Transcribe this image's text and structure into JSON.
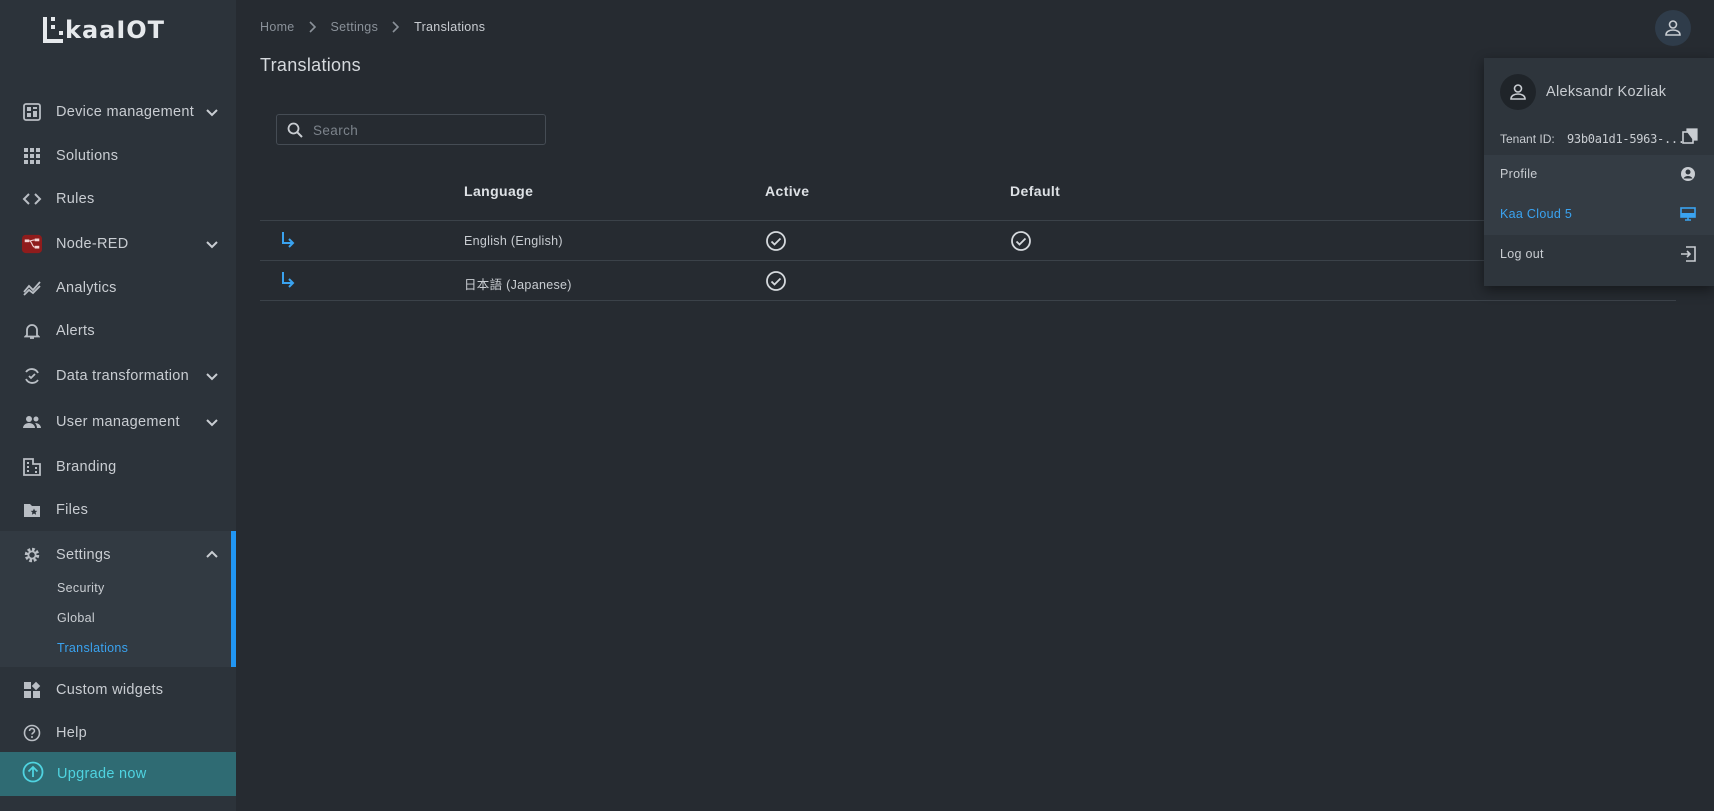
{
  "app": {
    "logo_text": "kaaIOT"
  },
  "sidebar": {
    "items": [
      {
        "label": "Device management",
        "icon": "device-dashboard-icon",
        "expandable": true
      },
      {
        "label": "Solutions",
        "icon": "grid-icon"
      },
      {
        "label": "Rules",
        "icon": "code-icon"
      },
      {
        "label": "Node-RED",
        "icon": "node-red-icon",
        "expandable": true
      },
      {
        "label": "Analytics",
        "icon": "analytics-icon"
      },
      {
        "label": "Alerts",
        "icon": "bell-icon"
      },
      {
        "label": "Data transformation",
        "icon": "transform-icon",
        "expandable": true
      },
      {
        "label": "User management",
        "icon": "users-icon",
        "expandable": true
      },
      {
        "label": "Branding",
        "icon": "building-icon"
      },
      {
        "label": "Files",
        "icon": "folder-star-icon"
      },
      {
        "label": "Settings",
        "icon": "gear-icon",
        "expanded": true
      },
      {
        "label": "Custom widgets",
        "icon": "widgets-icon"
      },
      {
        "label": "Help",
        "icon": "help-icon"
      }
    ],
    "settings_sub": [
      {
        "label": "Security"
      },
      {
        "label": "Global"
      },
      {
        "label": "Translations",
        "active": true
      }
    ],
    "upgrade_label": "Upgrade now",
    "accent_color": "#2196f3"
  },
  "breadcrumb": [
    "Home",
    "Settings",
    "Translations"
  ],
  "page": {
    "title": "Translations"
  },
  "search": {
    "placeholder": "Search",
    "value": ""
  },
  "table": {
    "columns": [
      "Language",
      "Active",
      "Default"
    ],
    "rows": [
      {
        "language": "English (English)",
        "active": true,
        "default": true
      },
      {
        "language": "日本語 (Japanese)",
        "active": true,
        "default": false
      }
    ]
  },
  "account_menu": {
    "user_name": "Aleksandr Kozliak",
    "tenant_label": "Tenant ID:",
    "tenant_id": "93b0a1d1-5963-...",
    "items": [
      {
        "label": "Profile",
        "icon": "account-circle-icon"
      },
      {
        "label": "Kaa Cloud 5",
        "icon": "monitor-icon",
        "active": true
      },
      {
        "label": "Log out",
        "icon": "logout-icon"
      }
    ]
  }
}
